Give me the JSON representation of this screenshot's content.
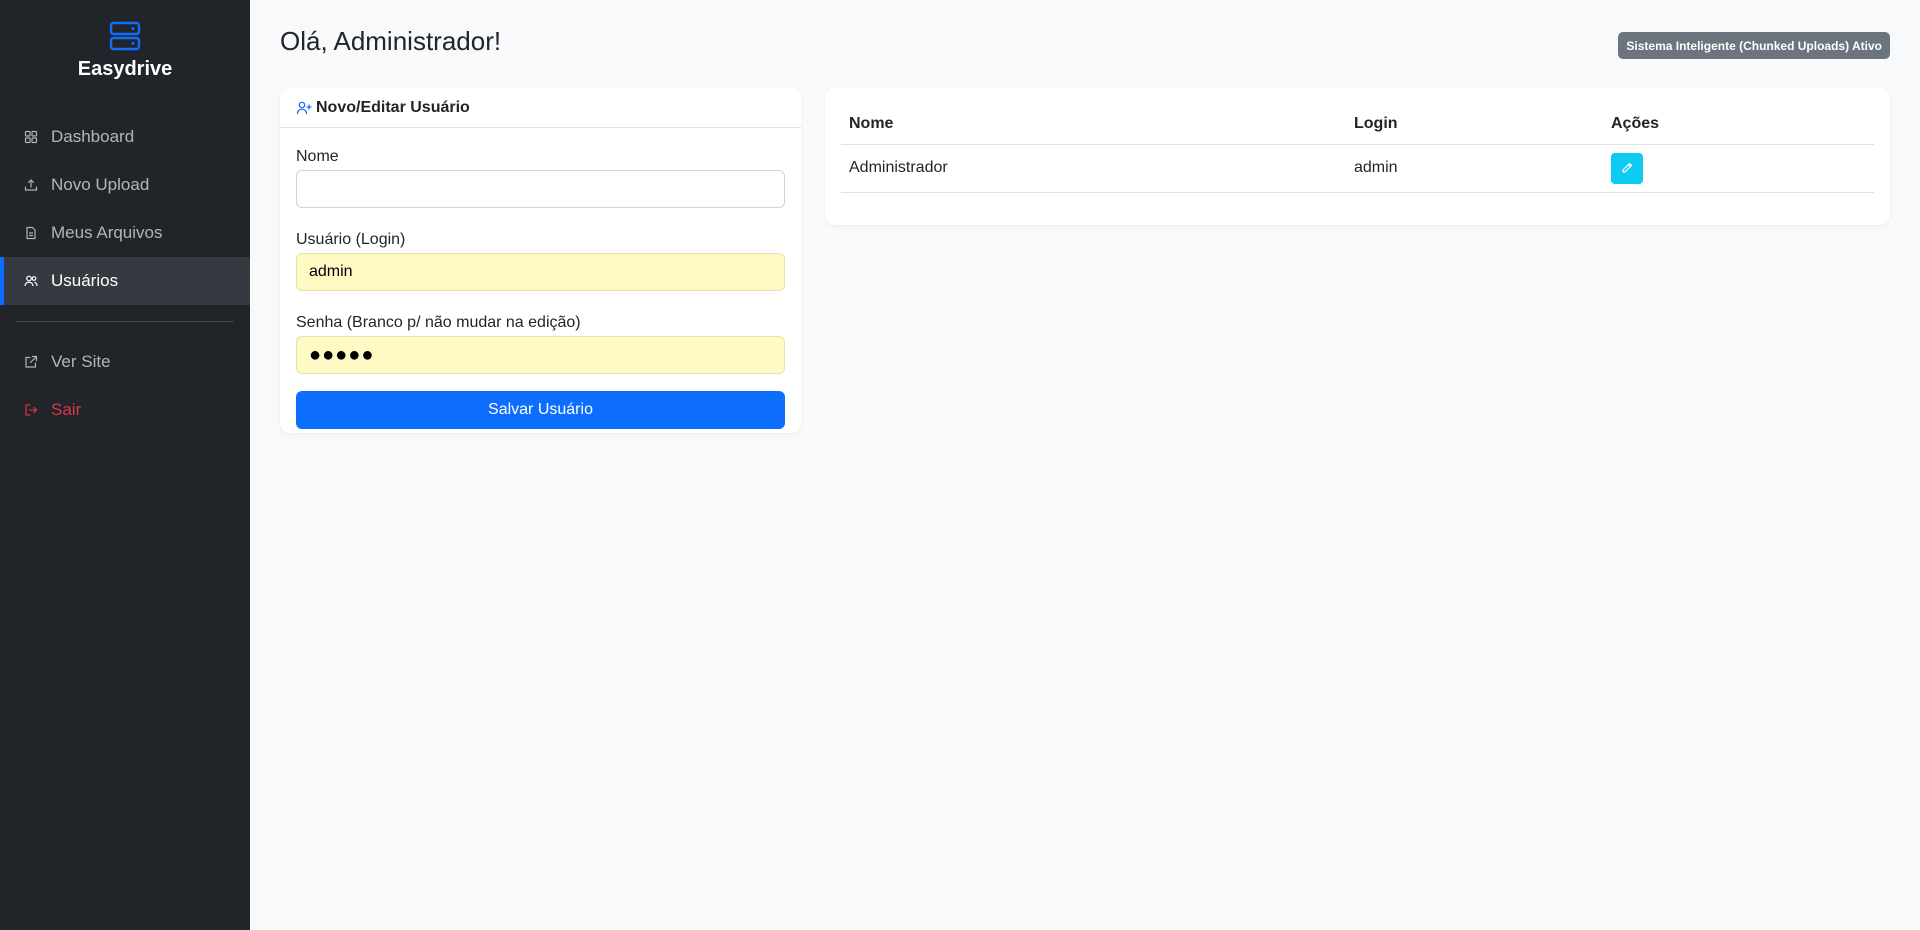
{
  "brand": {
    "title": "Easydrive",
    "icon": "server-icon",
    "accent": "#0d6efd"
  },
  "sidebar": {
    "items": [
      {
        "label": "Dashboard",
        "icon": "grid-icon"
      },
      {
        "label": "Novo Upload",
        "icon": "upload-icon"
      },
      {
        "label": "Meus Arquivos",
        "icon": "file-icon"
      },
      {
        "label": "Usuários",
        "icon": "users-icon",
        "active": true
      }
    ],
    "secondary": [
      {
        "label": "Ver Site",
        "icon": "external-link-icon"
      },
      {
        "label": "Sair",
        "icon": "logout-icon",
        "color": "#dc3545"
      }
    ]
  },
  "header": {
    "greeting": "Olá, Administrador!",
    "status_badge": "Sistema Inteligente (Chunked Uploads) Ativo"
  },
  "form": {
    "title": "Novo/Editar Usuário",
    "title_icon": "user-plus-icon",
    "name_label": "Nome",
    "name_value": "",
    "login_label": "Usuário (Login)",
    "login_value": "admin",
    "password_label": "Senha (Branco p/ não mudar na edição)",
    "password_value": "●●●●●",
    "save_label": "Salvar Usuário"
  },
  "users_table": {
    "columns": [
      "Nome",
      "Login",
      "Ações"
    ],
    "rows": [
      {
        "nome": "Administrador",
        "login": "admin",
        "action_icon": "pencil-icon"
      }
    ]
  }
}
